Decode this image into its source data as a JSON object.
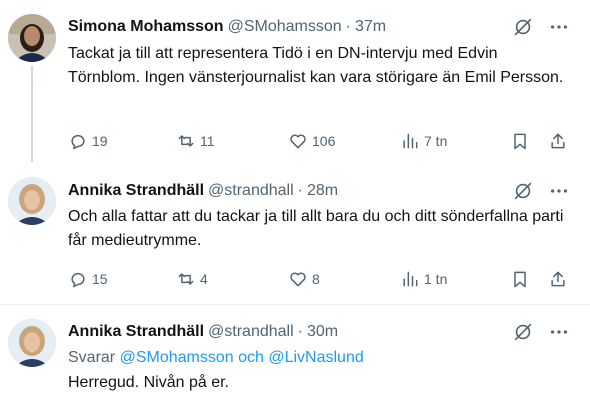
{
  "posts": [
    {
      "name": "Simona Mohamsson",
      "handle": "@SMohamsson",
      "sep": "·",
      "time": "37m",
      "text": "Tackat ja till att representera Tidö i en DN-intervju med Edvin Törnblom. Ingen vänsterjournalist kan vara störigare än Emil Persson.",
      "stats": {
        "replies": "19",
        "reposts": "11",
        "likes": "106",
        "views": "7 tn"
      }
    },
    {
      "name": "Annika Strandhäll",
      "handle": "@strandhall",
      "sep": "·",
      "time": "28m",
      "text": "Och alla fattar att du tackar ja till allt bara du och ditt sönderfallna parti får medieutrymme.",
      "stats": {
        "replies": "15",
        "reposts": "4",
        "likes": "8",
        "views": "1 tn"
      }
    },
    {
      "name": "Annika Strandhäll",
      "handle": "@strandhall",
      "sep": "·",
      "time": "30m",
      "reply_prefix": "Svarar",
      "reply_mention_1": "@SMohamsson",
      "reply_and": "och",
      "reply_mention_2": "@LivNaslund",
      "text": "Herregud. Nivån på er."
    }
  ],
  "icons": [
    "grok-icon",
    "more-icon",
    "reply-icon",
    "repost-icon",
    "like-icon",
    "views-icon",
    "bookmark-icon",
    "share-icon"
  ],
  "colors": {
    "text": "#0f1419",
    "secondary": "#536471",
    "link": "#1d9bf0",
    "divider": "#eff3f4"
  }
}
